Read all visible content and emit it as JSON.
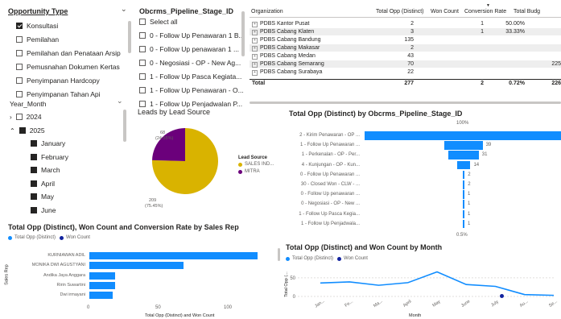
{
  "opportunity_slicer": {
    "title": "Opportunity Type",
    "items": [
      {
        "label": "Konsultasi",
        "checked": true
      },
      {
        "label": "Pemilahan",
        "checked": false
      },
      {
        "label": "Pemilahan dan Penataan Arsip",
        "checked": false
      },
      {
        "label": "Pemusnahan Dokumen Kertas",
        "checked": false
      },
      {
        "label": "Penyimpanan Hardcopy",
        "checked": false
      },
      {
        "label": "Penyimpanan Tahan Api",
        "checked": false
      }
    ]
  },
  "stage_slicer": {
    "title": "Obcrms_Pipeline_Stage_ID",
    "items": [
      {
        "label": "Select all",
        "checked": false
      },
      {
        "label": "0 - Follow Up Penawaran 1 B...",
        "checked": false
      },
      {
        "label": "0 - Follow Up penawaran 1 ...",
        "checked": false
      },
      {
        "label": "0 - Negosiasi - OP - New Ag...",
        "checked": false
      },
      {
        "label": "1 - Follow Up Pasca Kegiata...",
        "checked": false
      },
      {
        "label": "1 - Follow Up Penawaran - O...",
        "checked": false
      },
      {
        "label": "1 - Follow Up Penjadwalan P...",
        "checked": false
      }
    ]
  },
  "year_slicer": {
    "title": "Year_Month",
    "year_2024": "2024",
    "year_2025": "2025",
    "months": [
      "January",
      "February",
      "March",
      "April",
      "May",
      "June"
    ]
  },
  "matrix": {
    "headers": [
      "Organization",
      "Total Opp (Distinct)",
      "Won Count",
      "Conversion Rate",
      "Total Budg"
    ],
    "rows": [
      {
        "org": "PDBS Kantor Pusat",
        "opp": "2",
        "won": "1",
        "rate": "50.00%",
        "budget": ""
      },
      {
        "org": "PDBS Cabang Klaten",
        "opp": "3",
        "won": "1",
        "rate": "33.33%",
        "budget": ""
      },
      {
        "org": "PDBS Cabang Bandung",
        "opp": "135",
        "won": "",
        "rate": "",
        "budget": ""
      },
      {
        "org": "PDBS Cabang Makasar",
        "opp": "2",
        "won": "",
        "rate": "",
        "budget": ""
      },
      {
        "org": "PDBS Cabang Medan",
        "opp": "43",
        "won": "",
        "rate": "",
        "budget": ""
      },
      {
        "org": "PDBS Cabang Semarang",
        "opp": "70",
        "won": "",
        "rate": "",
        "budget": "225"
      },
      {
        "org": "PDBS Cabang Surabaya",
        "opp": "22",
        "won": "",
        "rate": "",
        "budget": ""
      }
    ],
    "total": {
      "label": "Total",
      "opp": "277",
      "won": "2",
      "rate": "0.72%",
      "budget": "226"
    }
  },
  "pie": {
    "title": "Leads by Lead Source",
    "legend_title": "Lead Source",
    "slices": [
      {
        "name": "SALES IND...",
        "value": 209,
        "pct": "(75.45%)",
        "color": "#d9b300"
      },
      {
        "name": "MITRA",
        "value": 68,
        "pct": "(24.55%)",
        "color": "#6b007b"
      }
    ],
    "label_mitra_value": "68",
    "label_mitra_pct": "(24.55%)",
    "label_sales_value": "209",
    "label_sales_pct": "(75.45%)"
  },
  "funnel": {
    "title": "Total Opp (Distinct) by Obcrms_Pipeline_Stage_ID",
    "top_pct": "100%",
    "bottom_pct": "0.5%",
    "stages": [
      {
        "label": "2 - Kirim Penawaran - OP ...",
        "value": 200,
        "value_label": ""
      },
      {
        "label": "1 - Follow Up Penawaran ...",
        "value": 39,
        "value_label": "39"
      },
      {
        "label": "1 - Perkenalan - OP - Per...",
        "value": 31,
        "value_label": "31"
      },
      {
        "label": "4 - Kunjungan - OP - Kun...",
        "value": 14,
        "value_label": "14"
      },
      {
        "label": "0 - Follow Up Penawaran ...",
        "value": 2,
        "value_label": "2"
      },
      {
        "label": "30 - Closed Won - CLW - ...",
        "value": 2,
        "value_label": "2"
      },
      {
        "label": "0 - Follow Up penawaran ...",
        "value": 1,
        "value_label": "1"
      },
      {
        "label": "0 - Negosiasi - OP - New ...",
        "value": 1,
        "value_label": "1"
      },
      {
        "label": "1 - Follow Up Pasca Kegia...",
        "value": 1,
        "value_label": "1"
      },
      {
        "label": "1 - Follow Up Penjadwala...",
        "value": 1,
        "value_label": "1"
      }
    ],
    "color": "#118dff"
  },
  "rep_chart": {
    "title": "Total Opp (Distinct), Won Count and Conversion Rate by Sales Rep",
    "legend": [
      {
        "name": "Total Opp (Distinct)",
        "color": "#118dff"
      },
      {
        "name": "Won Count",
        "color": "#12239e"
      }
    ],
    "ylabel": "Sales Rep",
    "xlabel": "Total Opp (Distinct) and Won Count",
    "xticks": [
      "0",
      "50",
      "100"
    ],
    "reps": [
      {
        "name": "KURNIAWAN ADIL",
        "value": 123
      },
      {
        "name": "MONIKA DWI AGUSTYANI",
        "value": 69
      },
      {
        "name": "Andika Jaya Anggara",
        "value": 19
      },
      {
        "name": "Ririn Suwartini",
        "value": 19
      },
      {
        "name": "Dwi irmayani",
        "value": 17
      }
    ]
  },
  "chart_data": {
    "type": "line",
    "title": "Total Opp (Distinct) and Won Count by Month",
    "xlabel": "Month",
    "ylabel": "Total Opp (...",
    "ylim": [
      0,
      80
    ],
    "yticks": [
      "0",
      "50"
    ],
    "categories": [
      "Jan...",
      "Fe...",
      "Ma...",
      "April",
      "May",
      "June",
      "July",
      "Au...",
      "Se..."
    ],
    "series": [
      {
        "name": "Total Opp (Distinct)",
        "color": "#118dff",
        "values": [
          36,
          39,
          30,
          37,
          66,
          32,
          27,
          5,
          3
        ]
      },
      {
        "name": "Won Count",
        "color": "#12239e",
        "values": [
          null,
          null,
          null,
          null,
          null,
          null,
          1,
          null,
          null
        ]
      }
    ]
  }
}
